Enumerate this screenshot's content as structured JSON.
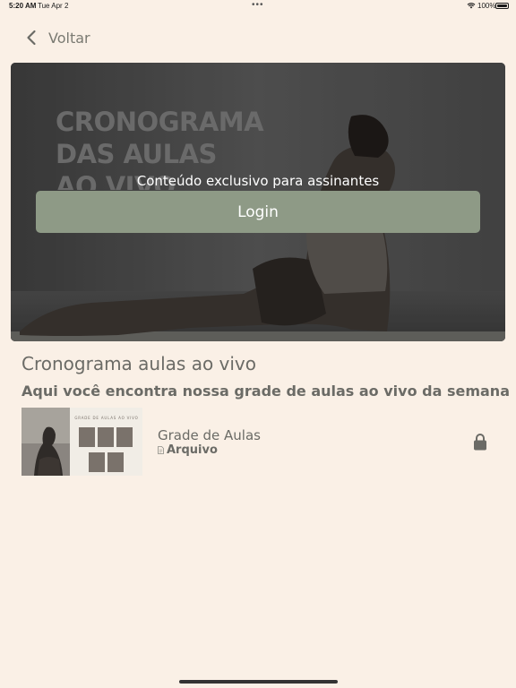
{
  "status_bar": {
    "time": "5:20 AM",
    "date": "Tue Apr 2",
    "dots": "•••",
    "battery": "100%"
  },
  "nav": {
    "back_label": "Voltar"
  },
  "hero": {
    "image_title_lines": [
      "CRONOGRAMA",
      "DAS AULAS",
      "AO VIVO"
    ],
    "overlay_text": "Conteúdo exclusivo para assinantes",
    "login_label": "Login"
  },
  "content": {
    "title": "Cronograma aulas ao vivo",
    "subtitle": "Aqui você encontra nossa grade de aulas ao vivo da semana"
  },
  "items": [
    {
      "title": "Grade de Aulas",
      "type": "Arquivo",
      "thumb_heading": "GRADE DE AULAS AO VIVO",
      "locked": true
    }
  ],
  "colors": {
    "background": "#faf0e6",
    "accent": "#8e9a86",
    "text": "#6b6b66"
  }
}
